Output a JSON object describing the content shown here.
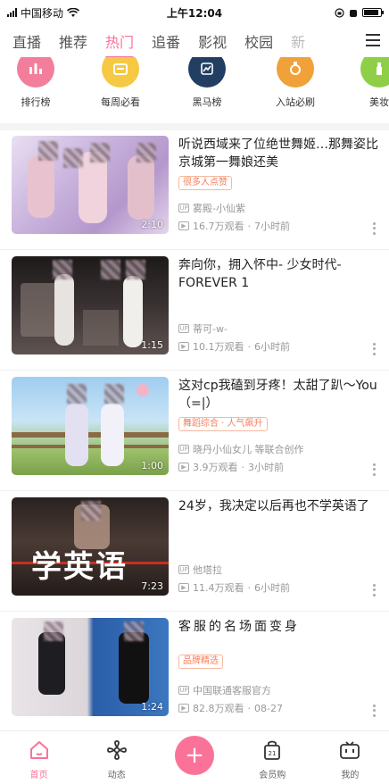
{
  "status_bar": {
    "carrier": "中国移动",
    "time": "上午12:04",
    "battery_level": 0.9
  },
  "tabs": [
    {
      "label": "直播"
    },
    {
      "label": "推荐"
    },
    {
      "label": "热门",
      "active": true
    },
    {
      "label": "追番"
    },
    {
      "label": "影视"
    },
    {
      "label": "校园"
    },
    {
      "label": "新"
    }
  ],
  "accent_color": "#fb7299",
  "quick_entries": [
    {
      "label": "排行榜",
      "icon": "chart-bars-icon",
      "color": "#f27e9c"
    },
    {
      "label": "每周必看",
      "icon": "calendar-icon",
      "color": "#f6c944"
    },
    {
      "label": "黑马榜",
      "icon": "shield-chart-icon",
      "color": "#233e63"
    },
    {
      "label": "入站必刷",
      "icon": "medal-icon",
      "color": "#f0a13a"
    },
    {
      "label": "美妆",
      "icon": "cosmetics-icon",
      "color": "#8fcf47"
    }
  ],
  "videos": [
    {
      "title": "听说西域来了位绝世舞姬…那舞姿比京城第一舞娘还美",
      "badge": "很多人点赞",
      "uploader": "雾殿-小仙紫",
      "views": "16.7万观看",
      "time": "7小时前",
      "duration": "2:10"
    },
    {
      "title": "奔向你，拥入怀中- 少女时代- FOREVER 1",
      "badge": "",
      "uploader": "蒂可-w-",
      "views": "10.1万观看",
      "time": "6小时前",
      "duration": "1:15"
    },
    {
      "title": "这对cp我磕到牙疼！太甜了趴～You（=|）",
      "badge": "舞蹈综合 · 人气飙升",
      "uploader": "晓丹小仙女儿 等联合创作",
      "views": "3.9万观看",
      "time": "3小时前",
      "duration": "1:00"
    },
    {
      "title": "24岁，我决定以后再也不学英语了",
      "badge": "",
      "uploader": "他塔拉",
      "views": "11.4万观看",
      "time": "6小时前",
      "duration": "7:23",
      "overlay_text": "学英语"
    },
    {
      "title": "客服的名场面变身",
      "badge": "品牌精选",
      "uploader": "中国联通客服官方",
      "views": "82.8万观看",
      "time": "08-27",
      "duration": "1:24"
    }
  ],
  "bottom_nav": [
    {
      "label": "首页",
      "icon": "home-icon",
      "active": true
    },
    {
      "label": "动态",
      "icon": "fan-icon"
    },
    {
      "label": "",
      "icon": "plus-icon"
    },
    {
      "label": "会员购",
      "icon": "shopping-bag-icon"
    },
    {
      "label": "我的",
      "icon": "tv-face-icon"
    }
  ]
}
